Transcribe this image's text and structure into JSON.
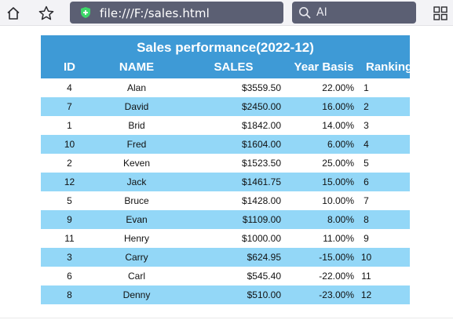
{
  "browser": {
    "url": "file:///F:/sales.html",
    "search_text": "AI"
  },
  "table": {
    "title": "Sales performance(2022-12)",
    "headers": {
      "id": "ID",
      "name": "NAME",
      "sales": "SALES",
      "basis": "Year Basis",
      "ranking": "Ranking"
    },
    "rows": [
      {
        "id": "4",
        "name": "Alan",
        "sales": "$3559.50",
        "basis": "22.00%",
        "trend": "positive",
        "ranking": "1"
      },
      {
        "id": "7",
        "name": "David",
        "sales": "$2450.00",
        "basis": "16.00%",
        "trend": "positive",
        "ranking": "2"
      },
      {
        "id": "1",
        "name": "Brid",
        "sales": "$1842.00",
        "basis": "14.00%",
        "trend": "positive",
        "ranking": "3"
      },
      {
        "id": "10",
        "name": "Fred",
        "sales": "$1604.00",
        "basis": "6.00%",
        "trend": "positive",
        "ranking": "4"
      },
      {
        "id": "2",
        "name": "Keven",
        "sales": "$1523.50",
        "basis": "25.00%",
        "trend": "positive",
        "ranking": "5"
      },
      {
        "id": "12",
        "name": "Jack",
        "sales": "$1461.75",
        "basis": "15.00%",
        "trend": "positive",
        "ranking": "6"
      },
      {
        "id": "5",
        "name": "Bruce",
        "sales": "$1428.00",
        "basis": "10.00%",
        "trend": "positive",
        "ranking": "7"
      },
      {
        "id": "9",
        "name": "Evan",
        "sales": "$1109.00",
        "basis": "8.00%",
        "trend": "positive",
        "ranking": "8"
      },
      {
        "id": "11",
        "name": "Henry",
        "sales": "$1000.00",
        "basis": "11.00%",
        "trend": "positive",
        "ranking": "9"
      },
      {
        "id": "3",
        "name": "Carry",
        "sales": "$624.95",
        "basis": "-15.00%",
        "trend": "negative",
        "ranking": "10"
      },
      {
        "id": "6",
        "name": "Carl",
        "sales": "$545.40",
        "basis": "-22.00%",
        "trend": "negative",
        "ranking": "11"
      },
      {
        "id": "8",
        "name": "Denny",
        "sales": "$510.00",
        "basis": "-23.00%",
        "trend": "negative",
        "ranking": "12"
      }
    ]
  },
  "colors": {
    "header_bg": "#3e9ad6",
    "stripe_bg": "#93d7f7",
    "positive": "#22d80e",
    "negative": "#ff1a1a",
    "url_bar_bg": "#5b5f73"
  },
  "icons": {
    "home": "home-icon",
    "favorite": "star-icon",
    "secure": "shield-plus-icon",
    "bolt": "lightning-bolt-icon",
    "dropdown": "chevron-down-icon",
    "search": "search-icon",
    "apps": "apps-grid-icon"
  }
}
